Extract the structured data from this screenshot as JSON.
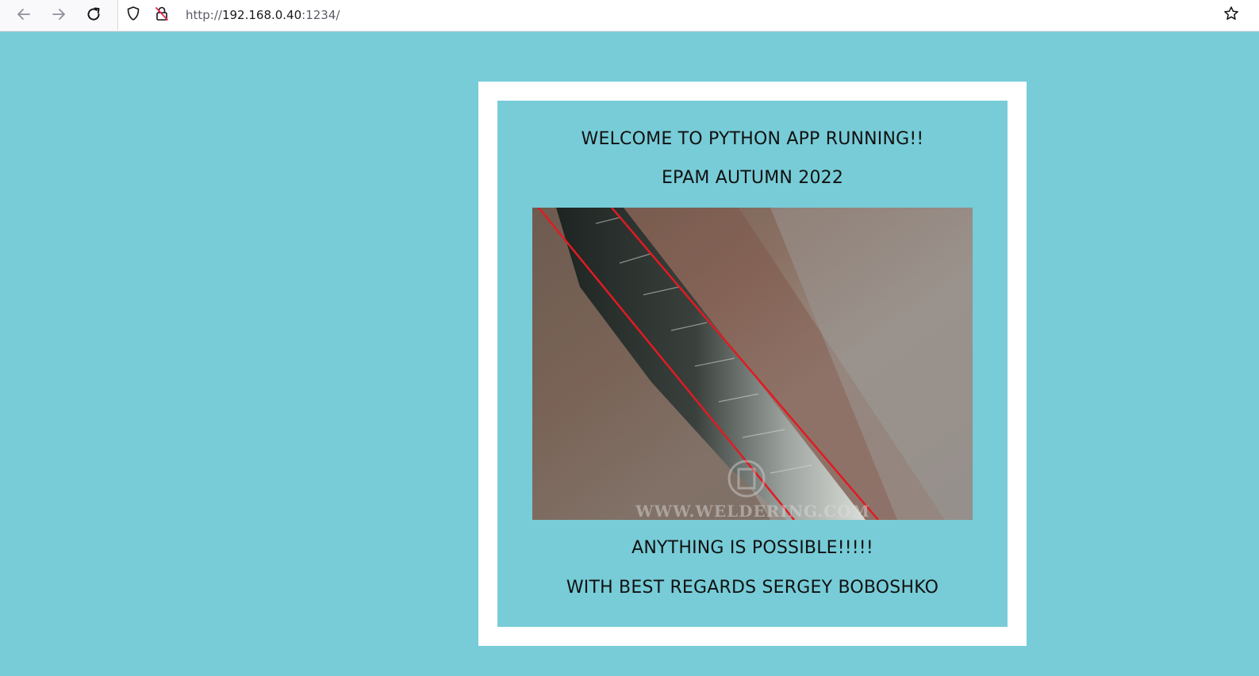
{
  "browser": {
    "url_scheme": "http://",
    "url_host": "192.168.0.40",
    "url_port": ":1234/",
    "icons": {
      "back": "back-arrow-icon",
      "forward": "forward-arrow-icon",
      "reload": "reload-icon",
      "tracking_protection": "shield-icon",
      "connection": "insecure-lock-icon",
      "bookmark": "star-icon"
    }
  },
  "page": {
    "background_color": "#77ccd7",
    "card_border_color": "#ffffff",
    "heading_1": "WELCOME TO PYTHON APP RUNNING!!",
    "heading_2": "EPAM AUTUMN 2022",
    "footer_1": "ANYTHING IS POSSIBLE!!!!!",
    "footer_2": "WITH BEST REGARDS SERGEY BOBOSHKO",
    "image": {
      "subject": "weld-seam-photo",
      "watermark": "WWW.WELDERING.COM"
    }
  }
}
